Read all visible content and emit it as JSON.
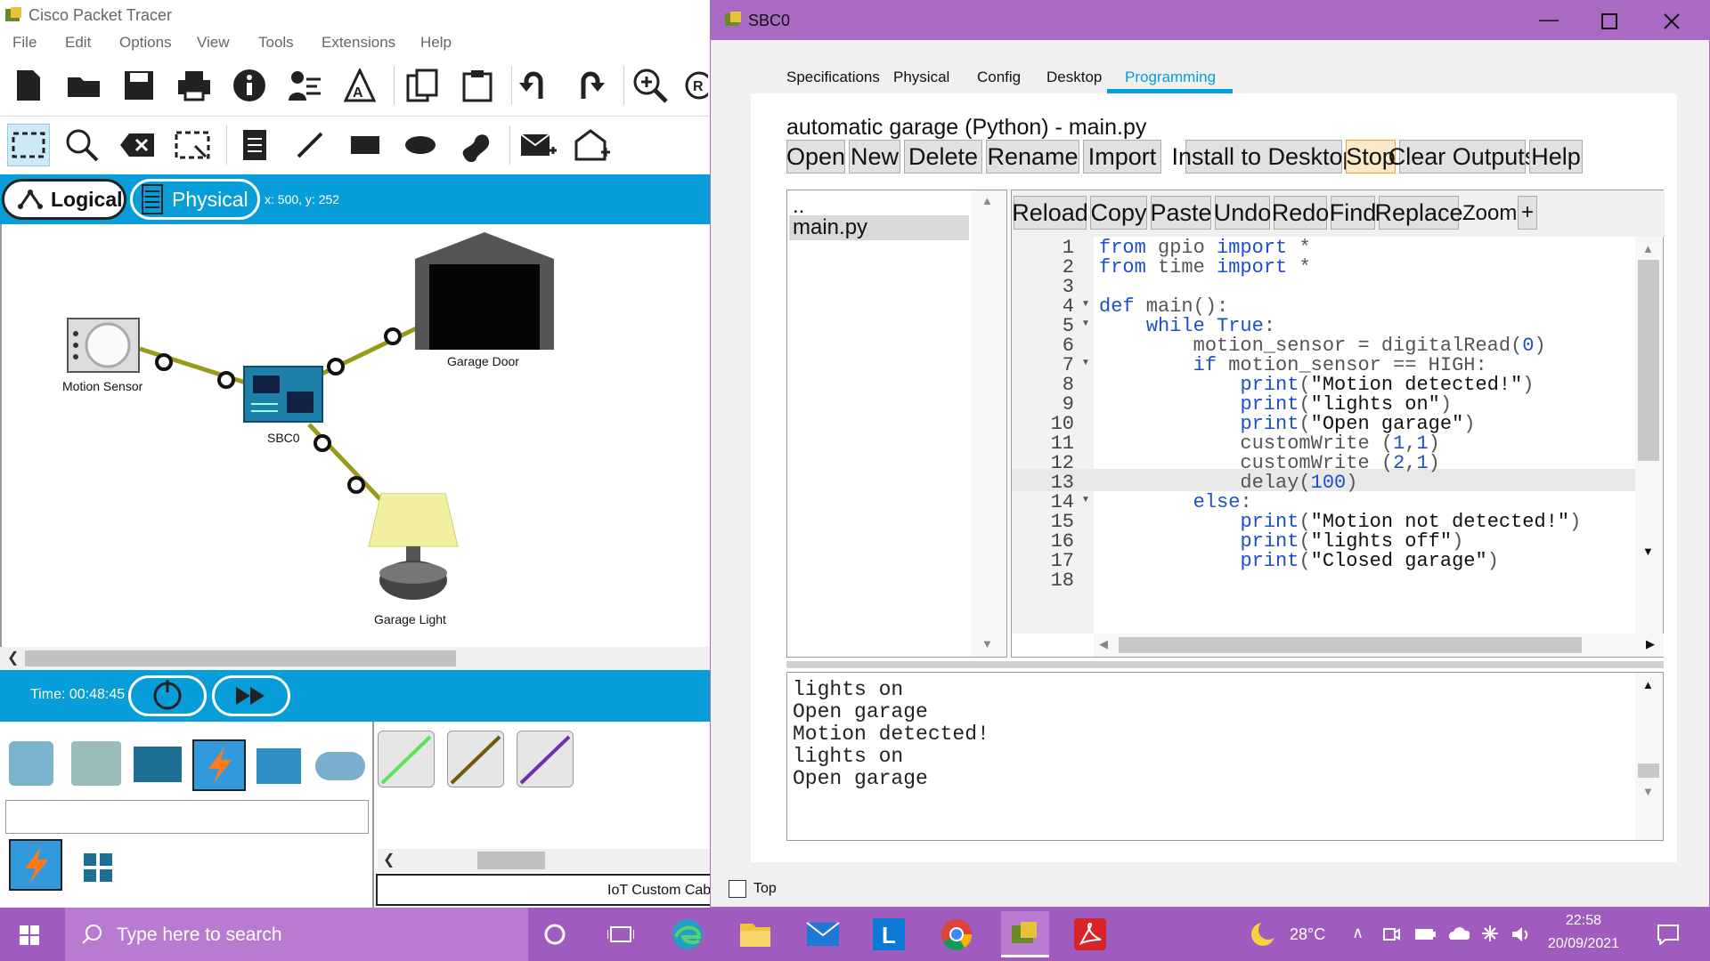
{
  "app": {
    "title": "Cisco Packet Tracer",
    "menu": [
      "File",
      "Edit",
      "Options",
      "View",
      "Tools",
      "Extensions",
      "Help"
    ]
  },
  "modes": {
    "logical": "Logical",
    "physical": "Physical",
    "coord": "x: 500, y: 252"
  },
  "devices": {
    "motion_sensor": "Motion Sensor",
    "sbc": "SBC0",
    "garage_door": "Garage Door",
    "garage_light": "Garage Light"
  },
  "time": {
    "label": "Time: 00:48:45"
  },
  "device_list": {
    "selected_name": "IoT Custom Cab"
  },
  "colors": {
    "accent": "#069dd8",
    "dialog_title": "#a96ac4",
    "taskbar": "#a05bbf",
    "link": "#069dd8",
    "cable": "#9a9a1a"
  },
  "dialog": {
    "title": "SBC0",
    "tabs": [
      "Specifications",
      "Physical",
      "Config",
      "Desktop",
      "Programming"
    ],
    "active_tab": "Programming",
    "project_title": "automatic garage (Python) - main.py",
    "project_buttons": [
      "Open",
      "New",
      "Delete",
      "Rename",
      "Import"
    ],
    "run_buttons": [
      "Install to Desktop",
      "Stop",
      "Clear Outputs",
      "Help"
    ],
    "files": [
      "..",
      "main.py"
    ],
    "editor_buttons": [
      "Reload",
      "Copy",
      "Paste",
      "Undo",
      "Redo",
      "Find",
      "Replace"
    ],
    "zoom_label": "Zoom:",
    "zoom_plus": "+",
    "line_numbers": [
      "1",
      "2",
      "3",
      "4",
      "5",
      "6",
      "7",
      "8",
      "9",
      "10",
      "11",
      "12",
      "13",
      "14",
      "15",
      "16",
      "17",
      "18"
    ],
    "output": [
      "lights on",
      "Open garage",
      "Motion detected!",
      "lights on",
      "Open garage"
    ],
    "top_checkbox": "Top"
  },
  "taskbar": {
    "search_placeholder": "Type here to search",
    "weather": "28°C",
    "time": "22:58",
    "date": "20/09/2021"
  }
}
